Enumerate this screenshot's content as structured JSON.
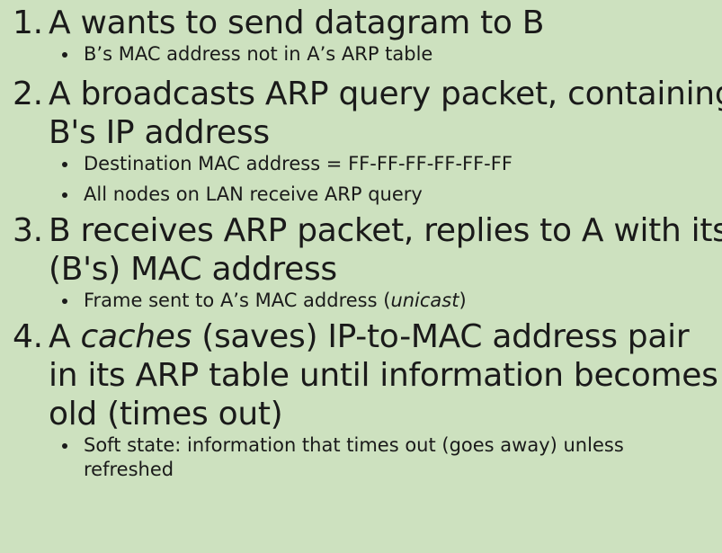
{
  "steps": [
    {
      "number": "1.",
      "lines": [
        "A wants to send datagram to B"
      ],
      "bullets": [
        "B’s MAC address not in A’s ARP table"
      ]
    },
    {
      "number": "2.",
      "lines": [
        "A broadcasts ARP query packet, containing",
        "B's IP address"
      ],
      "bullets": [
        "Destination MAC address = FF-FF-FF-FF-FF-FF",
        "All nodes on LAN receive ARP query"
      ]
    },
    {
      "number": "3.",
      "lines": [
        "B receives ARP packet, replies to A with its",
        "(B's) MAC address"
      ],
      "bullets_parts": {
        "before": "Frame sent to A’s MAC address (",
        "italic": "unicast",
        "after": ")"
      }
    },
    {
      "number": "4.",
      "line1_parts": {
        "before": "A ",
        "italic": "caches",
        "after": " (saves) IP-to-MAC address pair"
      },
      "lines": [
        "in its ARP table until information becomes",
        "old (times out)"
      ],
      "bullets": [
        "Soft state: information that times out (goes away) unless",
        "refreshed"
      ]
    }
  ]
}
